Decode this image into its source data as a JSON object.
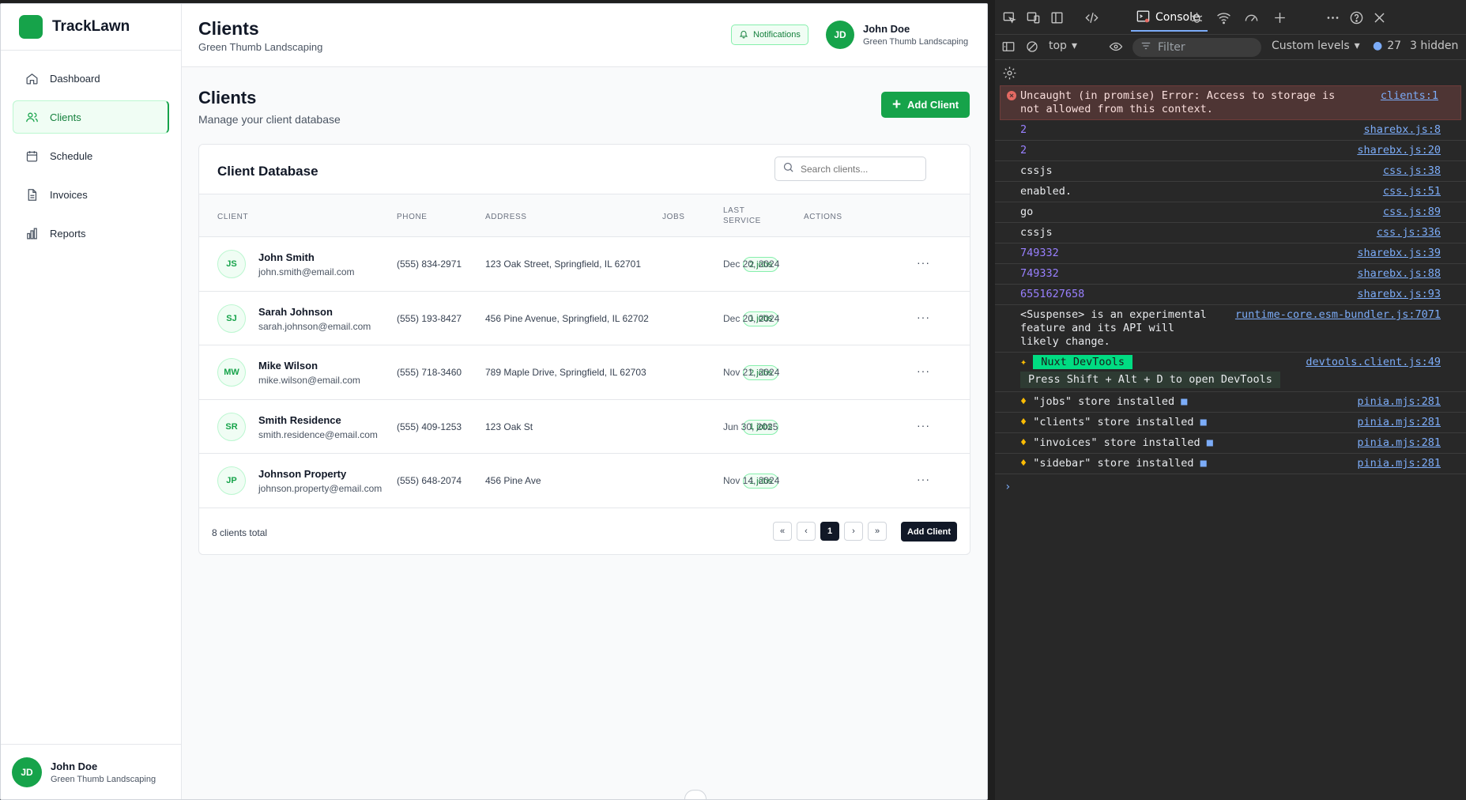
{
  "app": {
    "brand": "TrackLawn",
    "sidebar": {
      "items": [
        {
          "label": "Dashboard",
          "icon": "home-icon"
        },
        {
          "label": "Clients",
          "icon": "users-icon",
          "active": true
        },
        {
          "label": "Schedule",
          "icon": "calendar-icon"
        },
        {
          "label": "Invoices",
          "icon": "file-icon"
        },
        {
          "label": "Reports",
          "icon": "bar-chart-icon"
        }
      ],
      "user": {
        "initials": "JD",
        "name": "John Doe",
        "org": "Green Thumb Landscaping"
      }
    },
    "topbar": {
      "title": "Clients",
      "subtitle": "Green Thumb Landscaping",
      "notifications_label": "Notifications",
      "user": {
        "initials": "JD",
        "name": "John Doe",
        "org": "Green Thumb Landscaping"
      }
    },
    "page": {
      "title": "Clients",
      "subtitle": "Manage your client database",
      "add_button": "Add Client"
    },
    "table": {
      "title": "Client Database",
      "search_placeholder": "Search clients...",
      "columns": {
        "client": "CLIENT",
        "phone": "PHONE",
        "address": "ADDRESS",
        "jobs": "JOBS",
        "last_service_1": "LAST",
        "last_service_2": "SERVICE",
        "actions": "ACTIONS"
      },
      "rows": [
        {
          "initials": "JS",
          "name": "John Smith",
          "email": "john.smith@email.com",
          "phone": "(555) 834-2971",
          "address": "123 Oak Street, Springfield, IL 62701",
          "jobs": "2 jobs",
          "last_service": "Dec 20, 2024",
          "actions": "···"
        },
        {
          "initials": "SJ",
          "name": "Sarah Johnson",
          "email": "sarah.johnson@email.com",
          "phone": "(555) 193-8427",
          "address": "456 Pine Avenue, Springfield, IL 62702",
          "jobs": "1 jobs",
          "last_service": "Dec 20, 2024",
          "actions": "···"
        },
        {
          "initials": "MW",
          "name": "Mike Wilson",
          "email": "mike.wilson@email.com",
          "phone": "(555) 718-3460",
          "address": "789 Maple Drive, Springfield, IL 62703",
          "jobs": "2 jobs",
          "last_service": "Nov 21, 2024",
          "actions": "···"
        },
        {
          "initials": "SR",
          "name": "Smith Residence",
          "email": "smith.residence@email.com",
          "phone": "(555) 409-1253",
          "address": "123 Oak St",
          "jobs": "1 jobs",
          "last_service": "Jun 30, 2025",
          "actions": "···"
        },
        {
          "initials": "JP",
          "name": "Johnson Property",
          "email": "johnson.property@email.com",
          "phone": "(555) 648-2074",
          "address": "456 Pine Ave",
          "jobs": "1 jobs",
          "last_service": "Nov 14, 2024",
          "actions": "···"
        }
      ],
      "total": "8 clients total",
      "pager": {
        "first": "«",
        "prev": "‹",
        "current": "1",
        "next": "›",
        "last": "»"
      },
      "footer_add": "Add Client"
    }
  },
  "devtools": {
    "active_tab": "Console",
    "context": "top",
    "filter_placeholder": "Filter",
    "levels": "Custom levels",
    "issues_count": "27",
    "hidden": "3 hidden",
    "error": {
      "text": "Uncaught (in promise) Error: Access to storage is not allowed from this context.",
      "source": "clients:1"
    },
    "logs": [
      {
        "text": "2",
        "source": "sharebx.js:8",
        "kind": "num"
      },
      {
        "text": "2",
        "source": "sharebx.js:20",
        "kind": "num"
      },
      {
        "text": "cssjs",
        "source": "css.js:38",
        "kind": "text"
      },
      {
        "text": "enabled.",
        "source": "css.js:51",
        "kind": "text"
      },
      {
        "text": "go",
        "source": "css.js:89",
        "kind": "text"
      },
      {
        "text": "cssjs",
        "source": "css.js:336",
        "kind": "text"
      },
      {
        "text": "749332",
        "source": "sharebx.js:39",
        "kind": "num"
      },
      {
        "text": "749332",
        "source": "sharebx.js:88",
        "kind": "num"
      },
      {
        "text": "6551627658",
        "source": "sharebx.js:93",
        "kind": "num"
      }
    ],
    "suspense": {
      "text": "<Suspense> is an experimental feature and its API will likely change.",
      "source": "runtime-core.esm-bundler.js:7071"
    },
    "nuxt": {
      "badge": "Nuxt DevTools",
      "hint": "Press Shift + Alt + D to open DevTools",
      "source": "devtools.client.js:49"
    },
    "stores": [
      {
        "text": "\"jobs\" store installed",
        "source": "pinia.mjs:281"
      },
      {
        "text": "\"clients\" store installed",
        "source": "pinia.mjs:281"
      },
      {
        "text": "\"invoices\" store installed",
        "source": "pinia.mjs:281"
      },
      {
        "text": "\"sidebar\" store installed",
        "source": "pinia.mjs:281"
      }
    ],
    "prompt": "›"
  }
}
